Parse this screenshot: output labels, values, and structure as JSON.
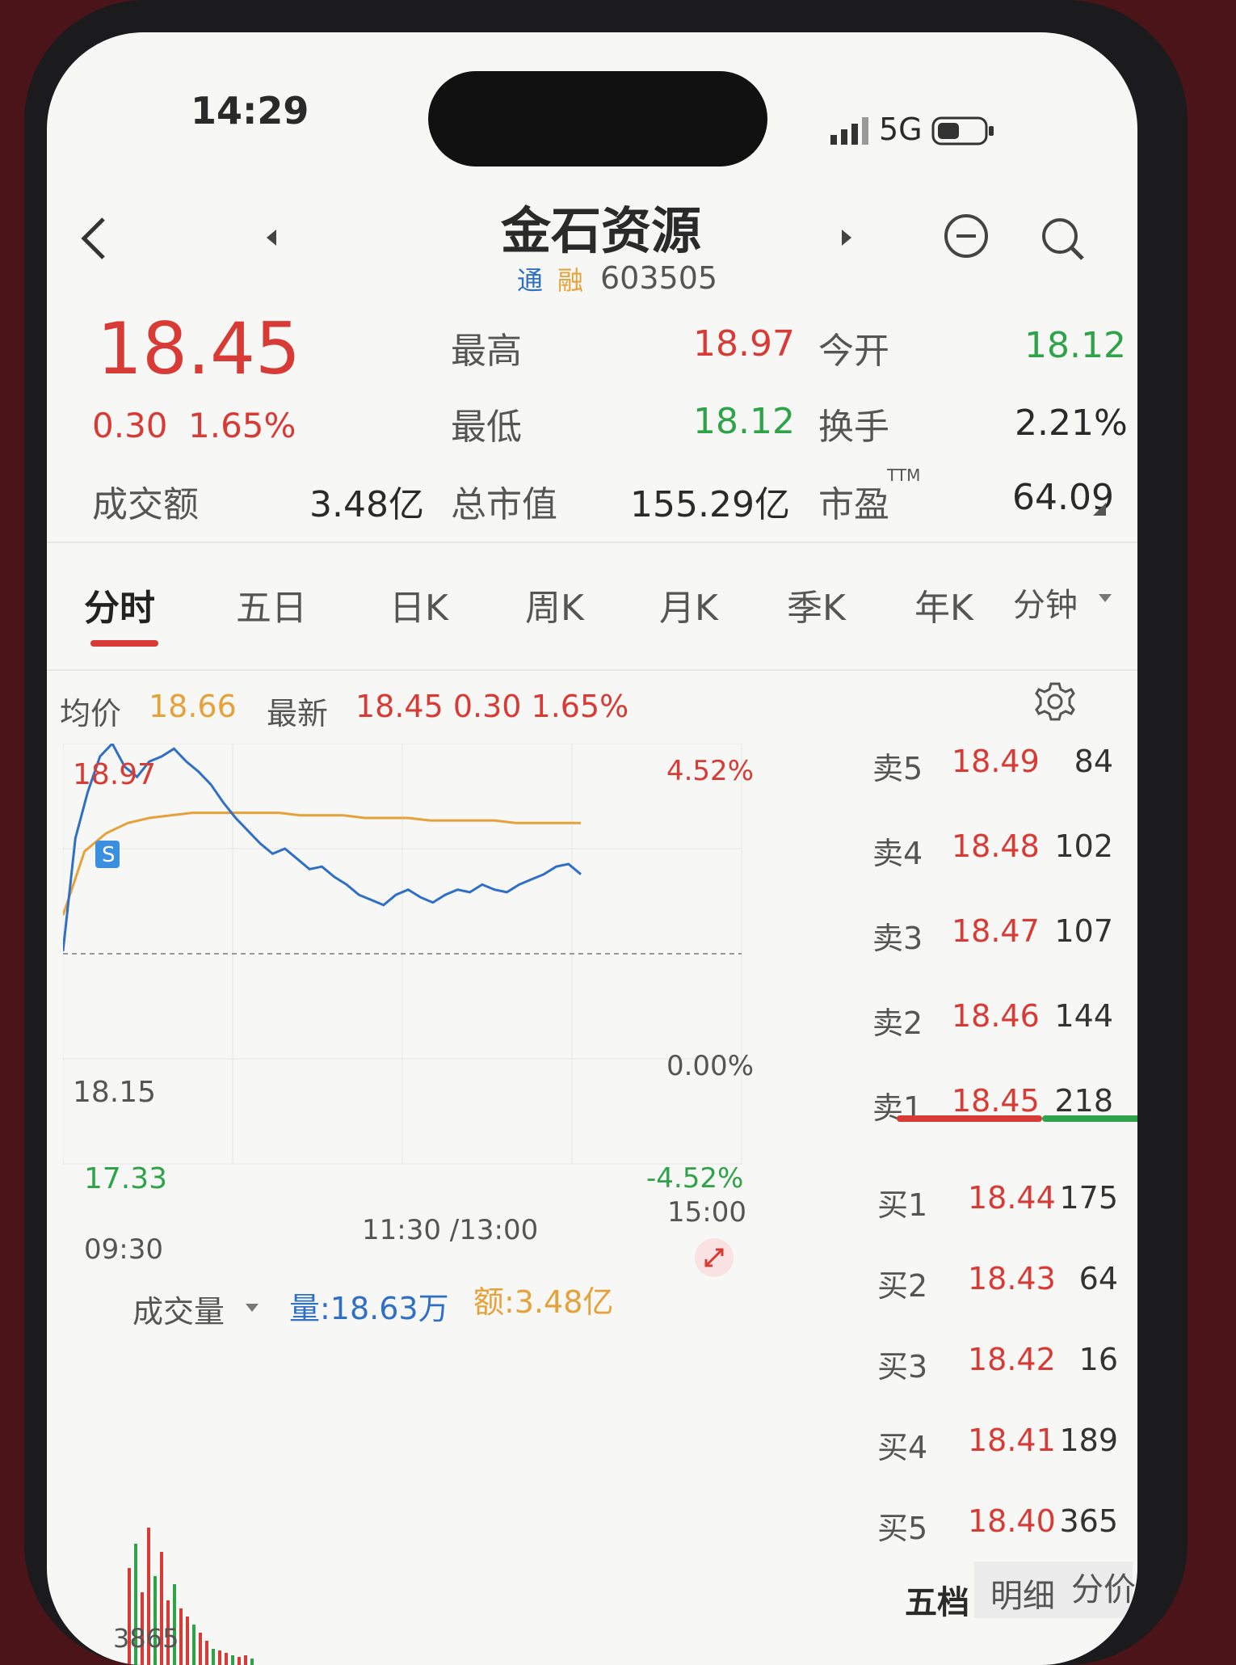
{
  "status_bar": {
    "time": "14:29",
    "network": "5G"
  },
  "header": {
    "title": "金石资源",
    "badge_tong": "通",
    "badge_rong": "融",
    "code": "603505"
  },
  "quote": {
    "price": "18.45",
    "change": "0.30",
    "change_pct": "1.65%",
    "high_label": "最高",
    "high": "18.97",
    "open_label": "今开",
    "open": "18.12",
    "low_label": "最低",
    "low": "18.12",
    "turnover_label": "换手",
    "turnover": "2.21%",
    "amount_label": "成交额",
    "amount": "3.48亿",
    "mktcap_label": "总市值",
    "mktcap": "155.29亿",
    "pe_label": "市盈",
    "pe_sup": "TTM",
    "pe": "64.09"
  },
  "tabs": [
    "分时",
    "五日",
    "日K",
    "周K",
    "月K",
    "季K",
    "年K",
    "分钟"
  ],
  "chart_info": {
    "avg_label": "均价",
    "avg": "18.66",
    "latest_label": "最新",
    "latest": "18.45 0.30 1.65%"
  },
  "chart_data": {
    "type": "line",
    "y_max_label": "18.97",
    "y_mid_label": "18.15",
    "y_min_label": "17.33",
    "pct_top": "4.52%",
    "pct_mid": "0.00%",
    "pct_bottom": "-4.52%",
    "x_labels": [
      "09:30",
      "11:30 /13:00",
      "15:00"
    ],
    "ylim": [
      17.33,
      18.97
    ],
    "series": [
      {
        "color": "#2f6fc4",
        "values": [
          18.16,
          18.6,
          18.78,
          18.92,
          18.97,
          18.88,
          18.84,
          18.9,
          18.92,
          18.95,
          18.9,
          18.86,
          18.81,
          18.74,
          18.68,
          18.63,
          18.58,
          18.54,
          18.56,
          18.52,
          18.48,
          18.49,
          18.45,
          18.42,
          18.38,
          18.36,
          18.34,
          18.38,
          18.4,
          18.37,
          18.35,
          18.38,
          18.4,
          18.39,
          18.42,
          18.4,
          18.39,
          18.42,
          18.44,
          18.46,
          18.49,
          18.5,
          18.46
        ]
      },
      {
        "color": "#e5a23a",
        "values": [
          18.3,
          18.55,
          18.62,
          18.66,
          18.68,
          18.69,
          18.7,
          18.7,
          18.7,
          18.7,
          18.7,
          18.69,
          18.69,
          18.69,
          18.68,
          18.68,
          18.68,
          18.67,
          18.67,
          18.67,
          18.67,
          18.66,
          18.66,
          18.66,
          18.66
        ]
      }
    ],
    "volume_sample": "3865"
  },
  "orderbook": {
    "asks": [
      {
        "label": "卖5",
        "price": "18.49",
        "vol": "84"
      },
      {
        "label": "卖4",
        "price": "18.48",
        "vol": "102"
      },
      {
        "label": "卖3",
        "price": "18.47",
        "vol": "107"
      },
      {
        "label": "卖2",
        "price": "18.46",
        "vol": "144"
      },
      {
        "label": "卖1",
        "price": "18.45",
        "vol": "218"
      }
    ],
    "bids": [
      {
        "label": "买1",
        "price": "18.44",
        "vol": "175"
      },
      {
        "label": "买2",
        "price": "18.43",
        "vol": "64"
      },
      {
        "label": "买3",
        "price": "18.42",
        "vol": "16"
      },
      {
        "label": "买4",
        "price": "18.41",
        "vol": "189"
      },
      {
        "label": "买5",
        "price": "18.40",
        "vol": "365"
      }
    ],
    "bottom_tabs": [
      "五档",
      "明细",
      "分价"
    ]
  },
  "volume": {
    "selector": "成交量",
    "qty": "量:18.63万",
    "amount": "额:3.48亿"
  },
  "colors": {
    "up": "#d83b36",
    "down": "#2fa34a",
    "price_line": "#2f6fc4",
    "avg_line": "#e5a23a"
  }
}
